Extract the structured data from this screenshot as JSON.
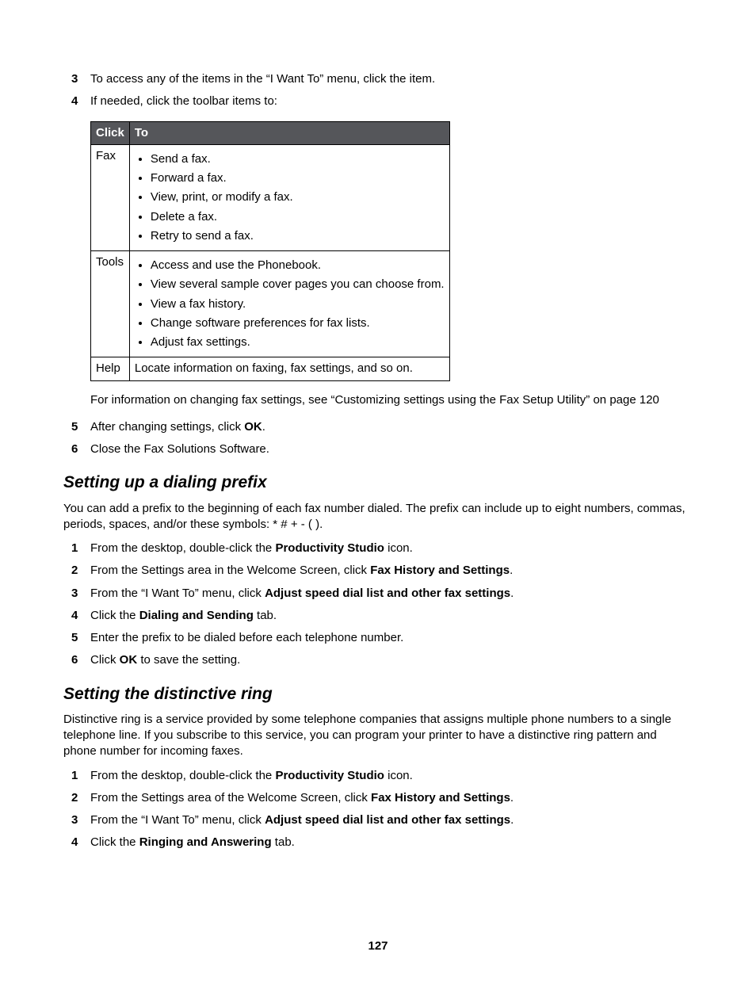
{
  "top_steps": {
    "s3": {
      "num": "3",
      "text": "To access any of the items in the “I Want To” menu, click the item."
    },
    "s4": {
      "num": "4",
      "text": "If needed, click the toolbar items to:"
    }
  },
  "table": {
    "header": {
      "c1": "Click",
      "c2": "To"
    },
    "rows": {
      "fax": {
        "label": "Fax",
        "items": [
          "Send a fax.",
          "Forward a fax.",
          "View, print, or modify a fax.",
          "Delete a fax.",
          "Retry to send a fax."
        ]
      },
      "tools": {
        "label": "Tools",
        "items": [
          "Access and use the Phonebook.",
          "View several sample cover pages you can choose from.",
          "View a fax history.",
          "Change software preferences for fax lists.",
          "Adjust fax settings."
        ]
      },
      "help": {
        "label": "Help",
        "text": "Locate information on faxing, fax settings, and so on."
      }
    }
  },
  "after_table_note": "For information on changing fax settings, see “Customizing settings using the Fax Setup Utility” on page 120",
  "top_steps2": {
    "s5": {
      "num": "5",
      "pre": "After changing settings, click ",
      "bold": "OK",
      "post": "."
    },
    "s6": {
      "num": "6",
      "text": "Close the Fax Solutions Software."
    }
  },
  "section1": {
    "heading": "Setting up a dialing prefix",
    "intro": "You can add a prefix to the beginning of each fax number dialed. The prefix can include up to eight numbers, commas, periods, spaces, and/or these symbols: * # + - ( ).",
    "steps": {
      "s1": {
        "num": "1",
        "pre": "From the desktop, double-click the ",
        "bold": "Productivity Studio",
        "post": " icon."
      },
      "s2": {
        "num": "2",
        "pre": "From the Settings area in the Welcome Screen, click ",
        "bold": "Fax History and Settings",
        "post": "."
      },
      "s3": {
        "num": "3",
        "pre": "From the “I Want To” menu, click ",
        "bold": "Adjust speed dial list and other fax settings",
        "post": "."
      },
      "s4": {
        "num": "4",
        "pre": "Click the ",
        "bold": "Dialing and Sending",
        "post": " tab."
      },
      "s5": {
        "num": "5",
        "text": "Enter the prefix to be dialed before each telephone number."
      },
      "s6": {
        "num": "6",
        "pre": "Click ",
        "bold": "OK",
        "post": " to save the setting."
      }
    }
  },
  "section2": {
    "heading": "Setting the distinctive ring",
    "intro": "Distinctive ring is a service provided by some telephone companies that assigns multiple phone numbers to a single telephone line. If you subscribe to this service, you can program your printer to have a distinctive ring pattern and phone number for incoming faxes.",
    "steps": {
      "s1": {
        "num": "1",
        "pre": "From the desktop, double-click the ",
        "bold": "Productivity Studio",
        "post": " icon."
      },
      "s2": {
        "num": "2",
        "pre": "From the Settings area of the Welcome Screen, click ",
        "bold": "Fax History and Settings",
        "post": "."
      },
      "s3": {
        "num": "3",
        "pre": "From the “I Want To” menu, click ",
        "bold": "Adjust speed dial list and other fax settings",
        "post": "."
      },
      "s4": {
        "num": "4",
        "pre": "Click the ",
        "bold": "Ringing and Answering",
        "post": " tab."
      }
    }
  },
  "page_number": "127"
}
